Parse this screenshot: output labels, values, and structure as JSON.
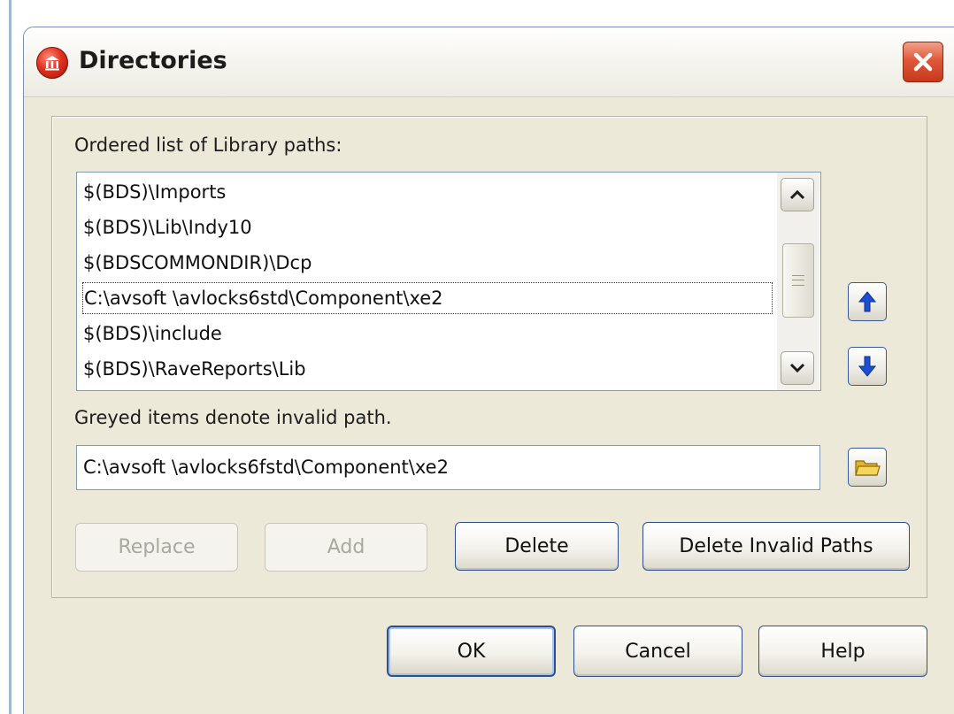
{
  "dialog": {
    "title": "Directories",
    "list_label": "Ordered list of Library paths:",
    "paths": [
      "$(BDS)\\Imports",
      "$(BDS)\\Lib\\Indy10",
      "$(BDSCOMMONDIR)\\Dcp",
      "C:\\avsoft \\avlocks6std\\Component\\xe2",
      "$(BDS)\\include",
      "$(BDS)\\RaveReports\\Lib"
    ],
    "focused_index": 3,
    "note": "Greyed items denote invalid path.",
    "path_input_value": "C:\\avsoft \\avlocks6fstd\\Component\\xe2",
    "buttons": {
      "replace": "Replace",
      "add": "Add",
      "delete": "Delete",
      "delete_invalid": "Delete Invalid Paths",
      "ok": "OK",
      "cancel": "Cancel",
      "help": "Help"
    },
    "icons": {
      "app": "app-icon",
      "close": "close-icon",
      "scroll_up": "chevron-up-icon",
      "scroll_down": "chevron-down-icon",
      "move_up": "arrow-up-icon",
      "move_down": "arrow-down-icon",
      "browse": "folder-icon"
    },
    "colors": {
      "dialog_bg": "#ece9d8",
      "close_button": "#e0583a",
      "arrow_blue": "#1a4fd6",
      "folder_yellow": "#f3cf4b"
    }
  }
}
